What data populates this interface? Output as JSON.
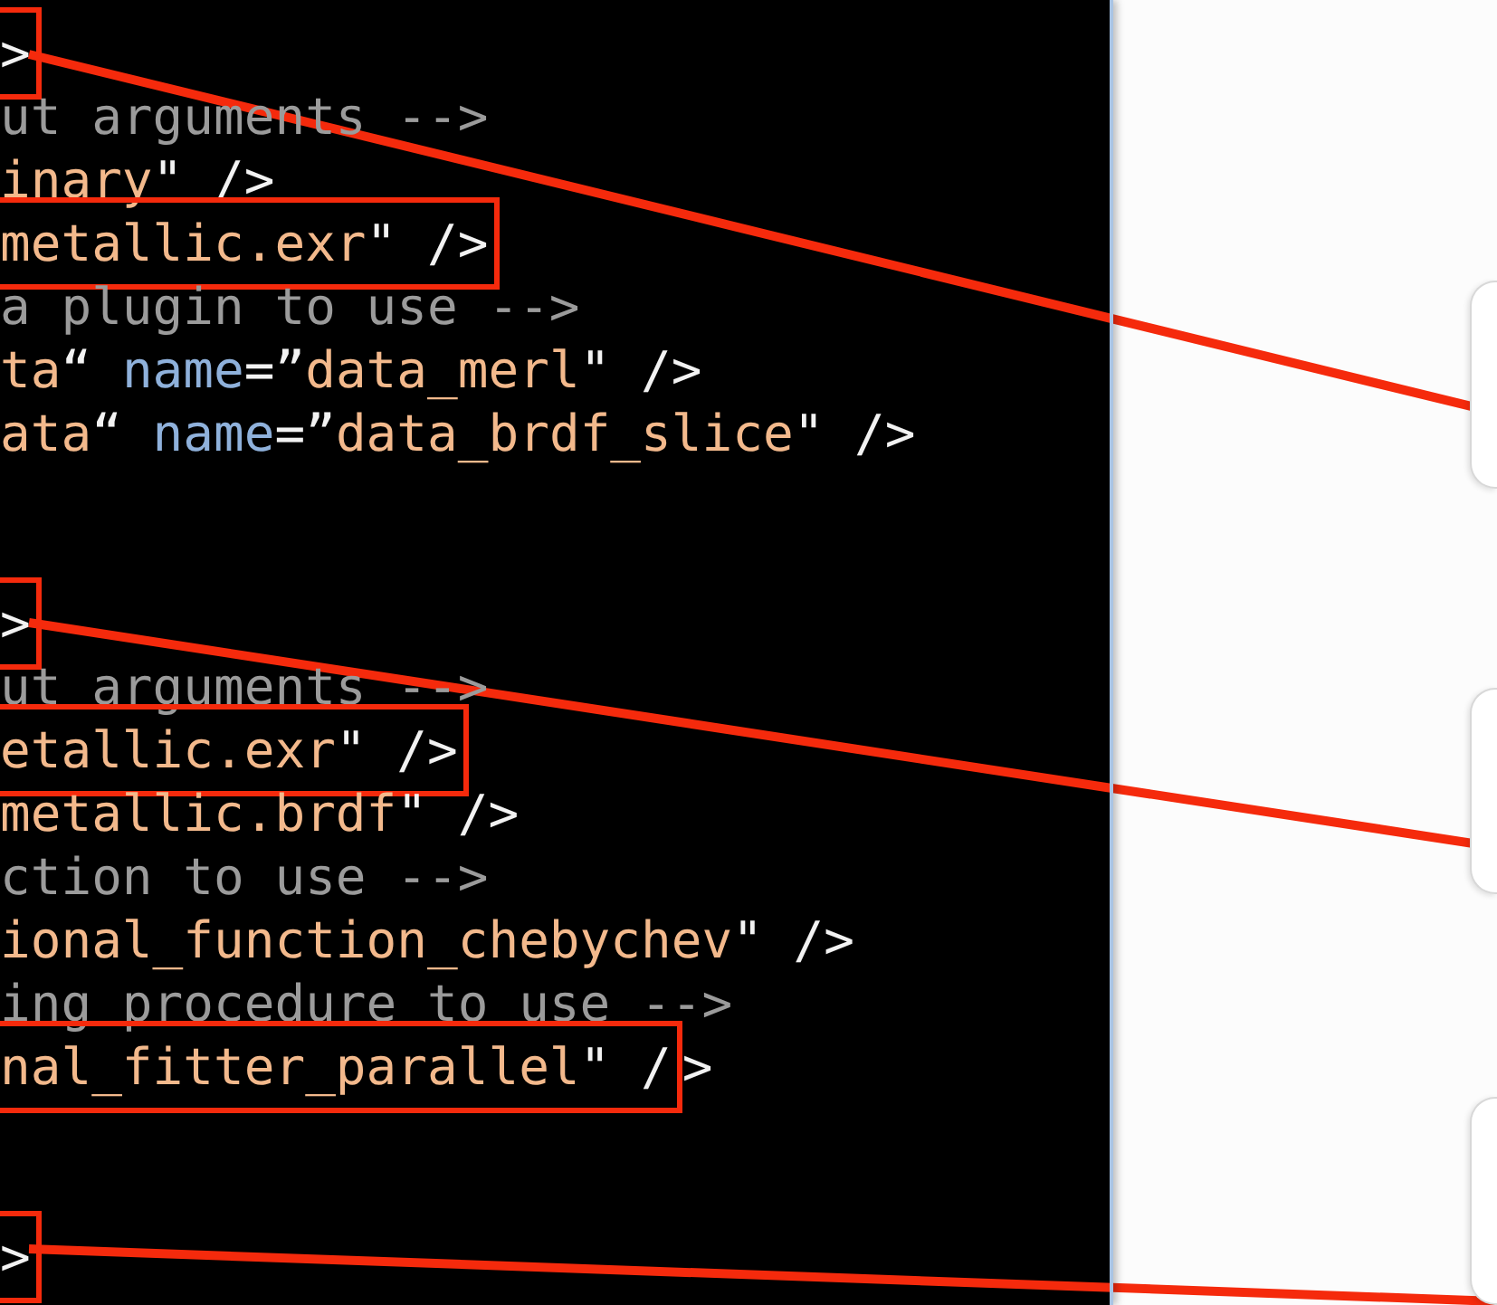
{
  "code_blocks": [
    {
      "lines": [
        {
          "segments": [
            {
              "kind": "plain",
              "text": ">",
              "boxed": true
            }
          ]
        },
        {
          "segments": [
            {
              "kind": "comment",
              "text": "ut arguments -->",
              "boxed": false
            }
          ]
        },
        {
          "segments": [
            {
              "kind": "string",
              "text": "inary",
              "boxed": false
            },
            {
              "kind": "plain",
              "text": "\" />",
              "boxed": false
            }
          ]
        },
        {
          "segments": [
            {
              "kind": "string",
              "text": "metallic.exr",
              "boxed": true
            },
            {
              "kind": "plain",
              "text": "\" />",
              "boxed": true
            }
          ]
        },
        {
          "segments": [
            {
              "kind": "comment",
              "text": "a plugin to use -->",
              "boxed": false
            }
          ]
        },
        {
          "segments": [
            {
              "kind": "string",
              "text": "ta",
              "boxed": false
            },
            {
              "kind": "plain",
              "text": "“ ",
              "boxed": false
            },
            {
              "kind": "attr",
              "text": "name",
              "boxed": false
            },
            {
              "kind": "plain",
              "text": "=”",
              "boxed": false
            },
            {
              "kind": "string",
              "text": "data_merl",
              "boxed": false
            },
            {
              "kind": "plain",
              "text": "\" />",
              "boxed": false
            }
          ]
        },
        {
          "segments": [
            {
              "kind": "string",
              "text": "ata",
              "boxed": false
            },
            {
              "kind": "plain",
              "text": "“ ",
              "boxed": false
            },
            {
              "kind": "attr",
              "text": "name",
              "boxed": false
            },
            {
              "kind": "plain",
              "text": "=”",
              "boxed": false
            },
            {
              "kind": "string",
              "text": "data_brdf_slice",
              "boxed": false
            },
            {
              "kind": "plain",
              "text": "\" />",
              "boxed": false
            }
          ]
        }
      ]
    },
    {
      "lines": [
        {
          "segments": [
            {
              "kind": "plain",
              "text": ">",
              "boxed": true
            }
          ]
        },
        {
          "segments": [
            {
              "kind": "comment",
              "text": "ut arguments -->",
              "boxed": false
            }
          ]
        },
        {
          "segments": [
            {
              "kind": "string",
              "text": "etallic.exr",
              "boxed": true
            },
            {
              "kind": "plain",
              "text": "\" />",
              "boxed": true
            }
          ]
        },
        {
          "segments": [
            {
              "kind": "string",
              "text": "metallic.brdf",
              "boxed": false
            },
            {
              "kind": "plain",
              "text": "\" />",
              "boxed": false
            }
          ]
        },
        {
          "segments": [
            {
              "kind": "comment",
              "text": "ction to use -->",
              "boxed": false
            }
          ]
        },
        {
          "segments": [
            {
              "kind": "string",
              "text": "ional_function_chebychev",
              "boxed": false
            },
            {
              "kind": "plain",
              "text": "\" />",
              "boxed": false
            }
          ]
        },
        {
          "segments": [
            {
              "kind": "comment",
              "text": "ing procedure to use -->",
              "boxed": false
            }
          ]
        },
        {
          "segments": [
            {
              "kind": "string",
              "text": "nal_fitter_parallel",
              "boxed": true
            },
            {
              "kind": "plain",
              "text": "\" /",
              "boxed": true
            },
            {
              "kind": "plain",
              "text": ">",
              "boxed": false
            }
          ]
        }
      ]
    },
    {
      "lines": [
        {
          "segments": [
            {
              "kind": "plain",
              "text": ">",
              "boxed": true
            }
          ]
        }
      ]
    }
  ]
}
